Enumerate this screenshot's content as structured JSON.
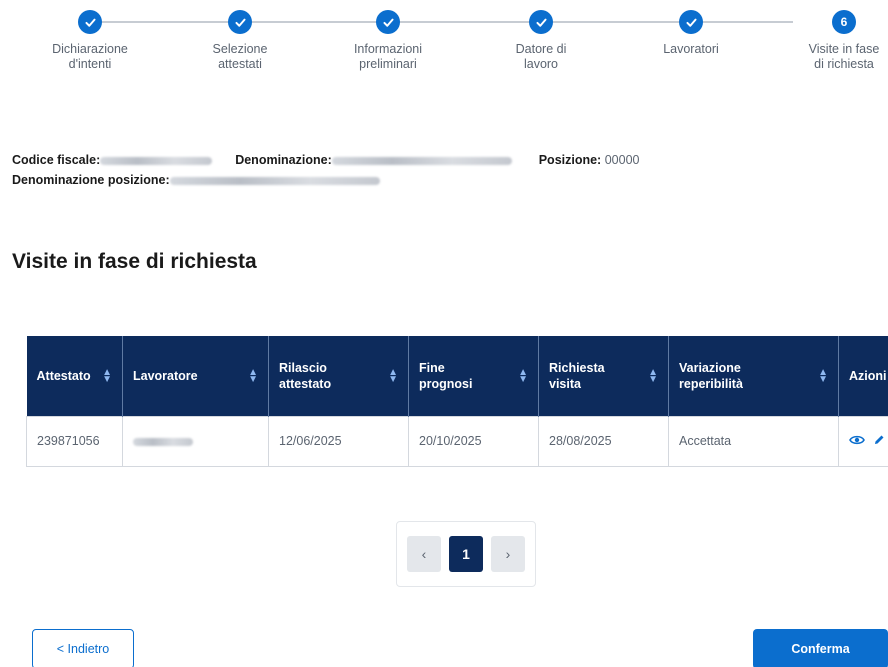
{
  "stepper": {
    "steps": [
      {
        "label": "Dichiarazione\nd'intenti",
        "state": "done",
        "number": ""
      },
      {
        "label": "Selezione\nattestati",
        "state": "done",
        "number": ""
      },
      {
        "label": "Informazioni\npreliminari",
        "state": "done",
        "number": ""
      },
      {
        "label": "Datore di\nlavoro",
        "state": "done",
        "number": ""
      },
      {
        "label": "Lavoratori",
        "state": "done",
        "number": ""
      },
      {
        "label": "Visite in fase\ndi richiesta",
        "state": "current",
        "number": "6"
      }
    ]
  },
  "info": {
    "codice_fiscale_label": "Codice fiscale:",
    "denominazione_label": "Denominazione:",
    "posizione_label": "Posizione:",
    "posizione_value": "00000",
    "denominazione_posizione_label": "Denominazione posizione:"
  },
  "page_title": "Visite in fase di richiesta",
  "table": {
    "headers": [
      {
        "label": "Attestato",
        "sortable": true
      },
      {
        "label": "Lavoratore",
        "sortable": true
      },
      {
        "label": "Rilascio attestato",
        "sortable": true
      },
      {
        "label": "Fine prognosi",
        "sortable": true
      },
      {
        "label": "Richiesta visita",
        "sortable": true
      },
      {
        "label": "Variazione reperibilità",
        "sortable": true
      },
      {
        "label": "Azioni",
        "sortable": false
      }
    ],
    "rows": [
      {
        "attestato": "239871056",
        "lavoratore": "",
        "rilascio": "12/06/2025",
        "fine_prognosi": "20/10/2025",
        "richiesta": "28/08/2025",
        "variazione": "Accettata"
      }
    ],
    "actions": {
      "view_icon": "eye-icon",
      "edit_icon": "pencil-icon",
      "info_icon": "info-icon"
    }
  },
  "pagination": {
    "prev": "‹",
    "current": "1",
    "next": "›"
  },
  "buttons": {
    "back": "< Indietro",
    "confirm": "Conferma"
  },
  "colors": {
    "primary": "#0b6ece",
    "header_bg": "#0d2b5c",
    "step_line": "#c7ccd3"
  }
}
